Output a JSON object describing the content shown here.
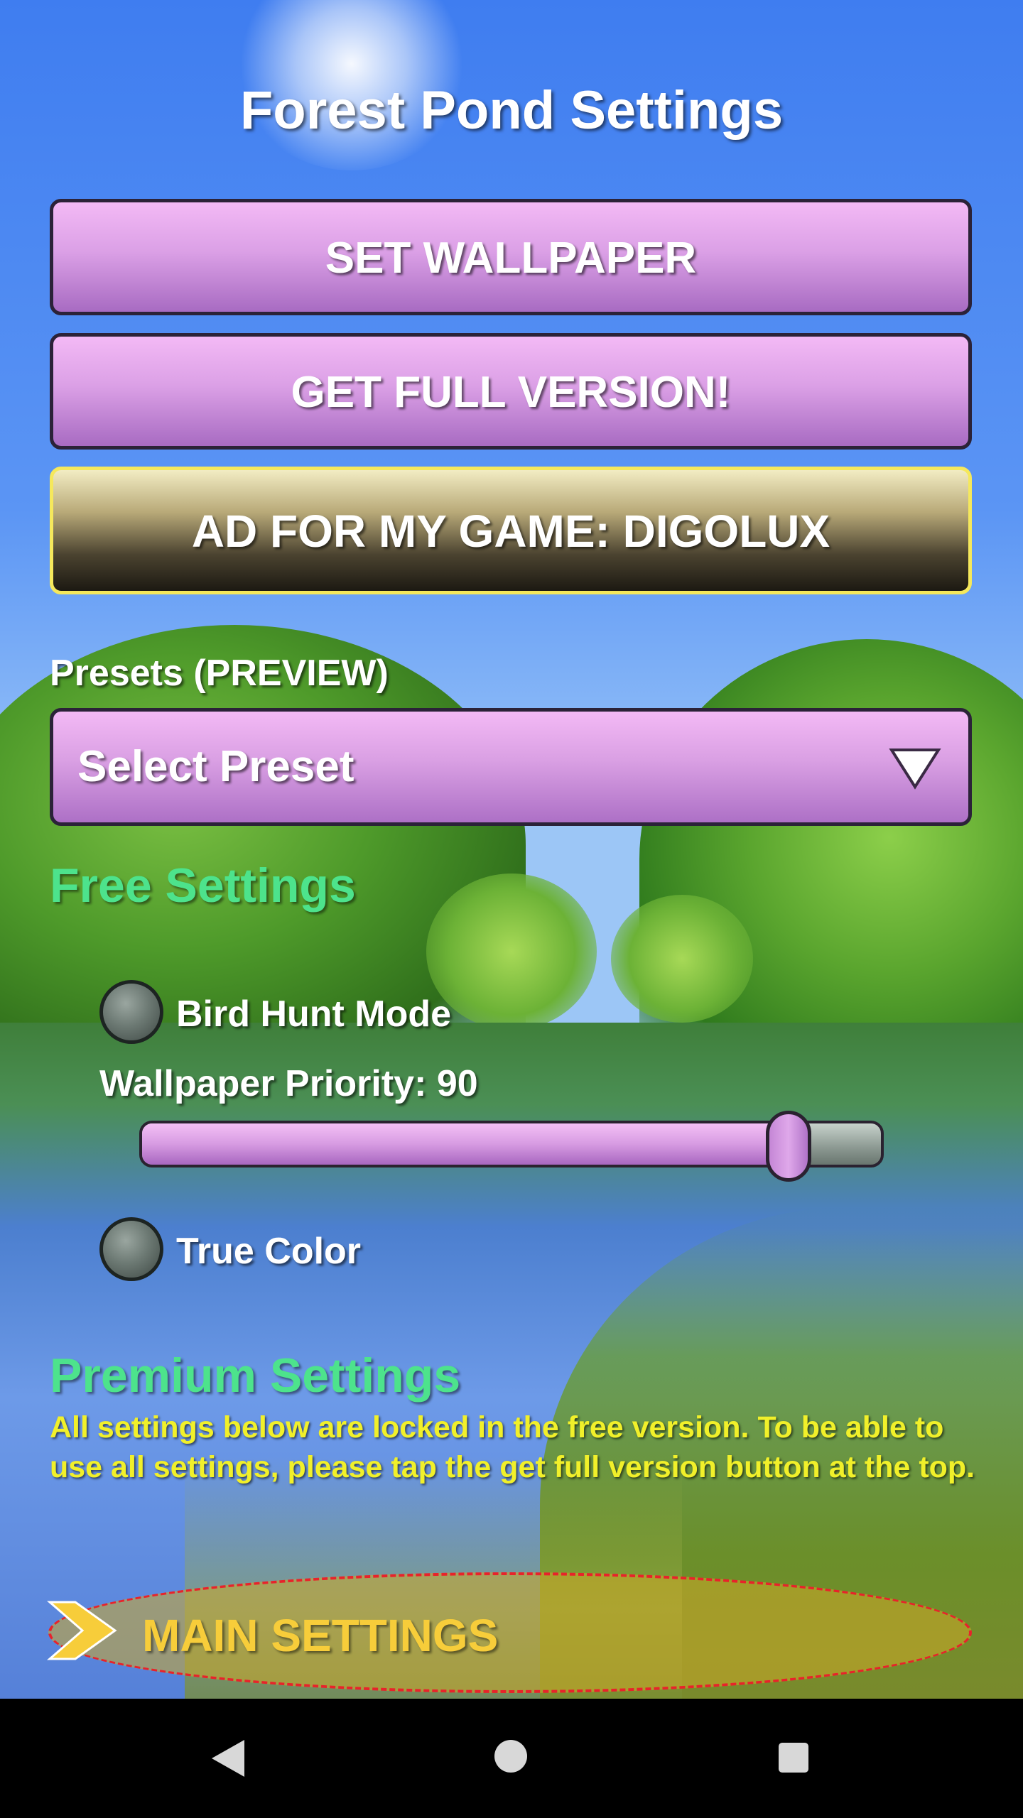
{
  "app": {
    "title": "Forest Pond Settings"
  },
  "buttons": {
    "set_wallpaper": "SET WALLPAPER",
    "get_full_version": "GET FULL VERSION!",
    "ad": "AD FOR MY GAME: DIGOLUX"
  },
  "presets": {
    "label": "Presets (PREVIEW)",
    "selected": "Select Preset"
  },
  "free_settings": {
    "heading": "Free Settings",
    "bird_hunt": {
      "label": "Bird Hunt Mode",
      "checked": false
    },
    "priority": {
      "label_prefix": "Wallpaper Priority:",
      "value": "90",
      "level_fraction": 0.9
    },
    "true_color": {
      "label": "True Color",
      "checked": false
    }
  },
  "premium_settings": {
    "heading": "Premium Settings",
    "notice": "All settings below are locked in the free version. To be able to use all settings, please tap the get full version button at the top."
  },
  "main_settings": {
    "label": "MAIN SETTINGS"
  },
  "colors": {
    "button_purple": "#dba0e6",
    "button_border": "#2b2238",
    "ad_border": "#f5e85c",
    "section_heading": "#4de38c",
    "notice_text": "#f1f02a",
    "main_settings_text": "#f7cd3a",
    "main_settings_outline": "#e8232a"
  },
  "icons": {
    "dropdown": "triangle-down-icon",
    "expand": "chevron-right-icon",
    "nav_back": "back-triangle-icon",
    "nav_home": "home-circle-icon",
    "nav_recent": "recent-square-icon"
  }
}
